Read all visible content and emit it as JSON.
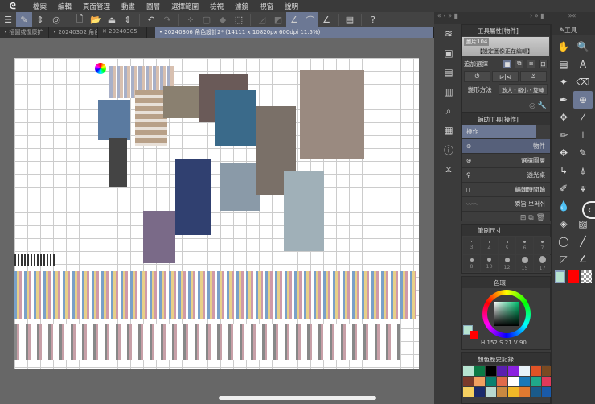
{
  "menu": {
    "items": [
      "檔案",
      "編輯",
      "頁面管理",
      "動畫",
      "圖層",
      "選擇範圍",
      "檢視",
      "濾鏡",
      "視窗",
      "說明"
    ]
  },
  "tabs": [
    {
      "label": "• 插圖或復康扩"
    },
    {
      "label": "• 20240302 角色"
    },
    {
      "label": "✕ 20240305"
    },
    {
      "label": "• 20240306 角色設計2* (14111 x 10820px 600dpi 11.5%)"
    }
  ],
  "tool_property": {
    "title": "工具屬性[物件]",
    "preview_name": "圖片104",
    "status": "【設定圖像正在編輯】",
    "add_select_label": "追加選擇",
    "transform_label": "變形方法",
    "transform_value": "放大・縮小・旋轉"
  },
  "sub_tool": {
    "title": "輔助工具[操作]",
    "group": "操作",
    "items": [
      {
        "label": "物件",
        "selected": true
      },
      {
        "label": "選擇圖層"
      },
      {
        "label": "透光桌"
      },
      {
        "label": "編輯時間軸"
      },
      {
        "label": "瞬旨 브러쉬"
      }
    ]
  },
  "tool_panel": {
    "title": "工具"
  },
  "brush_size": {
    "title": "筆刷尺寸",
    "sizes": [
      "3",
      "4",
      "5",
      "6",
      "7",
      "8",
      "10",
      "12",
      "15",
      "17"
    ]
  },
  "color_wheel": {
    "title": "色環",
    "h": "152",
    "s": "21",
    "v": "90",
    "main_color": "#b6e3d0",
    "sub_color": "#ff0000"
  },
  "color_history": {
    "title": "顏色歷史記錄",
    "colors": [
      "#b6e3d0",
      "#0b7a45",
      "#000000",
      "#5a1fb0",
      "#8a22e0",
      "#e8f2f8",
      "#e05326",
      "#7a4a22",
      "#7a3a2a",
      "#f0a060",
      "#0a8070",
      "#e06a4a",
      "#ffffff",
      "#1a78b8",
      "#20a88a",
      "#e03a5a",
      "#f5d060",
      "#1a2a6a",
      "#b8d8d0",
      "#c88840",
      "#f0b828",
      "#e07a30",
      "#1a5a8a",
      "#1a5aa8"
    ]
  }
}
